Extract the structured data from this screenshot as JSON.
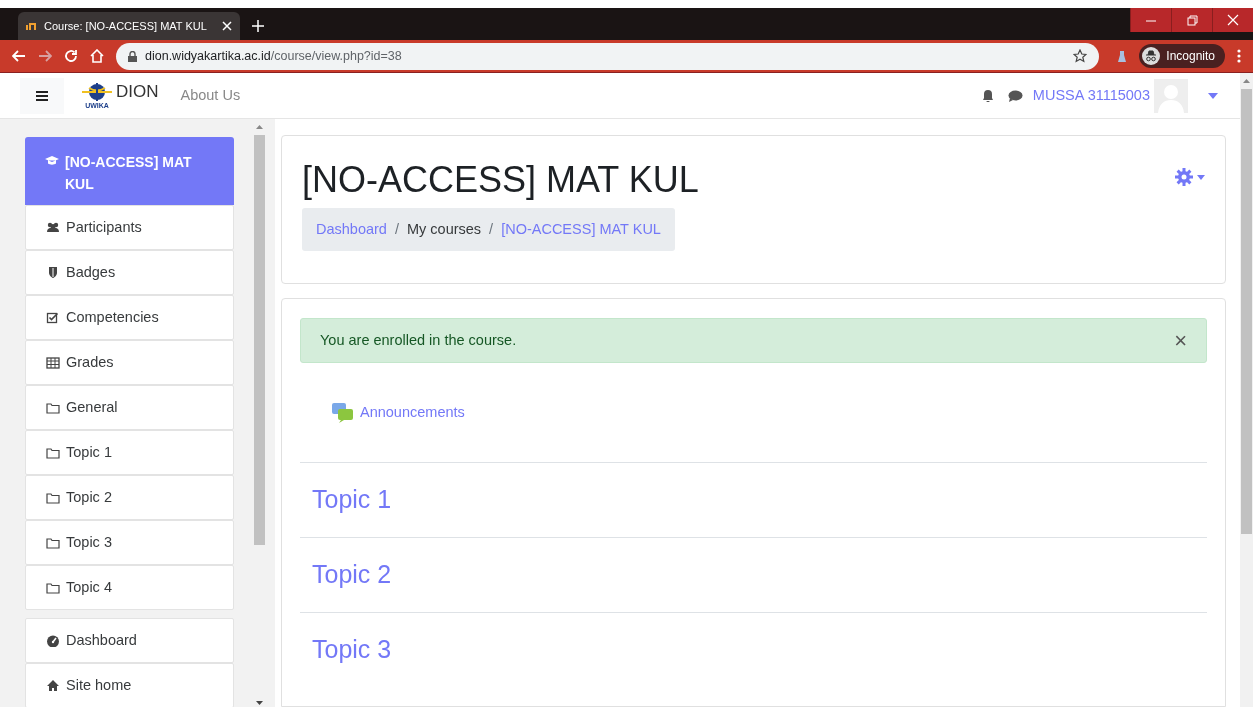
{
  "browser": {
    "tab_title": "Course: [NO-ACCESS] MAT KUL",
    "url_host": "dion.widyakartika.ac.id",
    "url_path": "/course/view.php?id=38",
    "profile": "Incognito"
  },
  "navbar": {
    "brand": "DION",
    "logo_caption": "UWIKA",
    "links": [
      "About Us"
    ],
    "user_name": "MUSSA 31115003"
  },
  "sidebar": {
    "groups": [
      [
        {
          "label": "[NO-ACCESS] MAT KUL",
          "selected": true
        },
        {
          "label": "Participants",
          "selected": false
        },
        {
          "label": "Badges",
          "selected": false
        },
        {
          "label": "Competencies",
          "selected": false
        },
        {
          "label": "Grades",
          "selected": false
        },
        {
          "label": "General",
          "selected": false
        },
        {
          "label": "Topic 1",
          "selected": false
        },
        {
          "label": "Topic 2",
          "selected": false
        },
        {
          "label": "Topic 3",
          "selected": false
        },
        {
          "label": "Topic 4",
          "selected": false
        }
      ],
      [
        {
          "label": "Dashboard",
          "selected": false
        },
        {
          "label": "Site home",
          "selected": false
        }
      ]
    ]
  },
  "header": {
    "title": "[NO-ACCESS] MAT KUL",
    "breadcrumb_separator": "/",
    "breadcrumb": [
      {
        "label": "Dashboard",
        "link": true
      },
      {
        "label": "My courses",
        "link": false
      },
      {
        "label": "[NO-ACCESS] MAT KUL",
        "link": true
      }
    ]
  },
  "alert": {
    "message": "You are enrolled in the course.",
    "close": "×"
  },
  "activities": [
    {
      "label": "Announcements"
    }
  ],
  "sections": [
    {
      "title": "Topic 1"
    },
    {
      "title": "Topic 2"
    },
    {
      "title": "Topic 3"
    }
  ]
}
